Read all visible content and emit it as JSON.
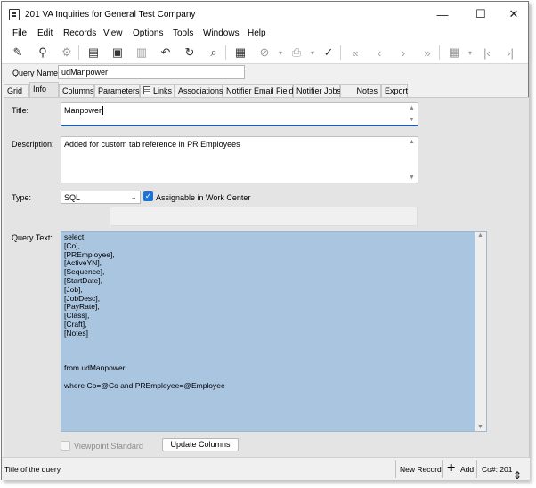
{
  "window": {
    "title": "201 VA Inquiries for General Test Company",
    "minimize": "—",
    "maximize": "☐",
    "close": "✕"
  },
  "menu": [
    "File",
    "Edit",
    "Records",
    "View",
    "Options",
    "Tools",
    "Windows",
    "Help"
  ],
  "toolbar": {
    "icons": [
      "edit-icon",
      "binoculars-icon",
      "gear-icon",
      "new-record-icon",
      "save-icon",
      "delete-icon",
      "undo-icon",
      "refresh-icon",
      "search-icon",
      "layout-icon",
      "attach-icon",
      "print-icon",
      "spellcheck-icon",
      "first-record-icon",
      "previous-record-icon",
      "next-record-icon",
      "last-record-icon",
      "grid-settings-icon",
      "first-page-icon",
      "last-page-icon"
    ]
  },
  "query_name": {
    "label": "Query Name:",
    "value": "udManpower"
  },
  "tabs": [
    "Grid",
    "Info",
    "Columns",
    "Parameters",
    "Links",
    "Associations",
    "Notifier Email Fields",
    "Notifier Jobs",
    "Notes",
    "Export"
  ],
  "active_tab": "Info",
  "form": {
    "title_label": "Title:",
    "title_value": "Manpower",
    "description_label": "Description:",
    "description_value": "Added for custom tab reference in PR Employees",
    "type_label": "Type:",
    "type_value": "SQL",
    "assignable_label": "Assignable in Work Center",
    "assignable_checked": true,
    "query_text_label": "Query Text:",
    "query_lines": [
      "select",
      "[Co],",
      "[PREmployee],",
      "[ActiveYN],",
      "[Sequence],",
      "[StartDate],",
      "[Job],",
      "[JobDesc],",
      "[PayRate],",
      "[Class],",
      "[Craft],",
      "[Notes]",
      "",
      "",
      "",
      "from udManpower",
      "",
      "where Co=@Co and PREmployee=@Employee"
    ],
    "viewpoint_standard_label": "Viewpoint Standard",
    "viewpoint_standard_checked": false,
    "update_columns_label": "Update Columns"
  },
  "status": {
    "message": "Title of the query.",
    "new_record": "New Record",
    "add": "Add",
    "company": "Co#: 201"
  },
  "colors": {
    "query_bg": "#a9c5e0",
    "checkbox_accent": "#1a73d9",
    "focus_underline": "#1f5fa8"
  }
}
